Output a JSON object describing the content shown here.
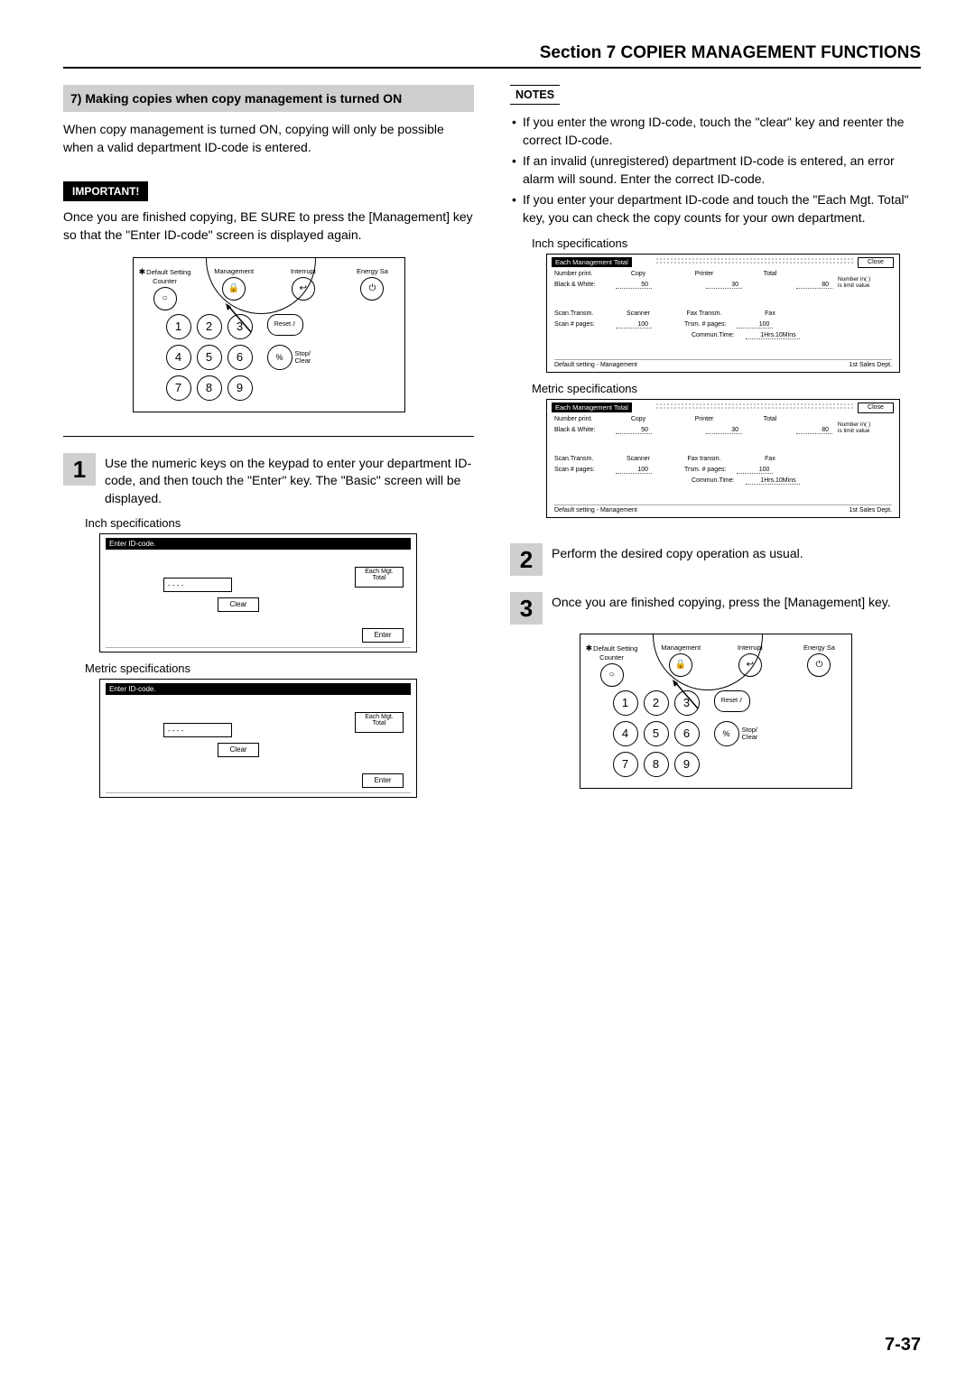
{
  "header": "Section 7  COPIER MANAGEMENT FUNCTIONS",
  "pageNumber": "7-37",
  "left": {
    "subHeading": "7)   Making copies when copy management is turned ON",
    "intro": "When copy management is turned ON, copying will only be possible when a valid department ID-code is entered.",
    "importantLabel": "IMPORTANT!",
    "importantText": "Once you are finished copying, BE SURE to press the [Management] key so that the \"Enter ID-code\" screen is displayed again.",
    "step1": {
      "num": "1",
      "text": "Use the numeric keys on the keypad to enter your department ID-code, and then touch the \"Enter\" key. The \"Basic\" screen will be displayed."
    },
    "inchLabel": "Inch specifications",
    "metricLabel": "Metric specifications"
  },
  "right": {
    "notesLabel": "NOTES",
    "bullets": [
      "If you enter the wrong ID-code, touch the \"clear\" key and reenter the correct ID-code.",
      "If an invalid (unregistered) department ID-code is entered, an error alarm will sound. Enter the correct ID-code.",
      "If you enter your department ID-code and touch the \"Each Mgt. Total\" key, you can check the copy counts for your own department."
    ],
    "inchLabel": "Inch specifications",
    "metricLabel": "Metric specifications",
    "step2": {
      "num": "2",
      "text": "Perform the desired copy operation as usual."
    },
    "step3": {
      "num": "3",
      "text": "Once you are finished copying, press the [Management] key."
    }
  },
  "keypad": {
    "buttons": [
      "Default Setting Counter",
      "Management",
      "Interrupt",
      "Energy Sa"
    ],
    "keys": [
      "1",
      "2",
      "3",
      "4",
      "5",
      "6",
      "7",
      "8",
      "9"
    ],
    "reset": "Reset",
    "stopClear": "Stop/\nClear",
    "stopSym": "%"
  },
  "lcd": {
    "title": "Enter ID-code.",
    "mask": "- - - -",
    "eachMgt": "Each Mgt.\nTotal",
    "clear": "Clear",
    "enter": "Enter"
  },
  "mgmt": {
    "title": "Each Management Total",
    "close": "Close",
    "row1_label": "Number print.",
    "row1_h1": "Copy",
    "row1_h2": "Printer",
    "row1_h3": "Total",
    "row2_label": "Black & White:",
    "row2_v1": "50",
    "row2_v2": "30",
    "row2_v3": "80",
    "rightNote": "Number in( )\nis limit value",
    "row3_label": "Scan.Transm.",
    "row3_h1": "Scanner",
    "row3_h2": "Fax Transm.",
    "row3_h3": "Fax",
    "row4_label": "Scan # pages:",
    "row4_v1": "100",
    "row4_midlabel": "Trsm. # pages:",
    "row4_v2": "100",
    "row5_midlabel": "Commun.Time:",
    "row5_v": "1Hrs.10Mins",
    "foot_left": "Default setting - Management",
    "foot_right": "1st Sales Dept."
  },
  "mgmt_metric": {
    "row3_h2": "Fax transm."
  }
}
